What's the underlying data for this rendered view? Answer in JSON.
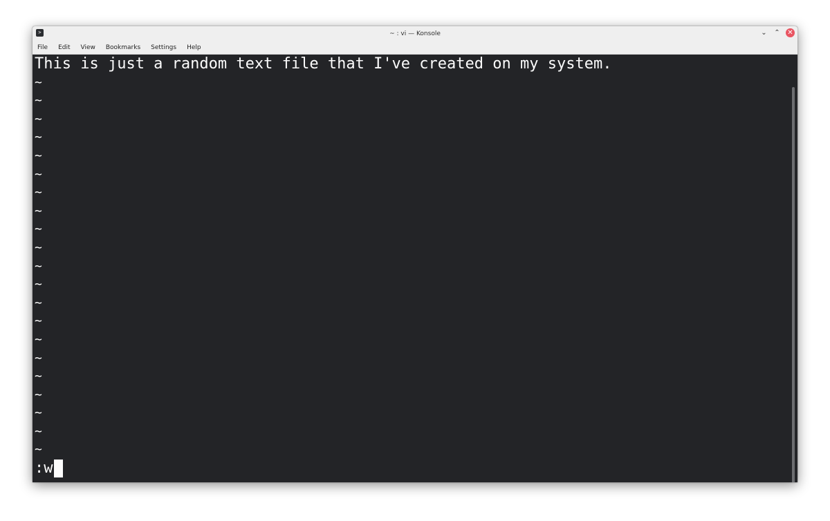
{
  "window": {
    "title": "~ : vi — Konsole",
    "icon": "konsole-terminal-icon",
    "controls": {
      "minimize": "⌄",
      "maximize": "⌃",
      "close": "✕"
    }
  },
  "menubar": {
    "items": [
      "File",
      "Edit",
      "View",
      "Bookmarks",
      "Settings",
      "Help"
    ]
  },
  "editor": {
    "first_line": "This is just a random text file that I've created on my system.",
    "empty_line_marker": "~",
    "empty_line_count": 21,
    "command": ":w"
  },
  "colors": {
    "terminal_bg": "#232427",
    "terminal_fg": "#fcfcfc",
    "titlebar_bg": "#efefef",
    "close_button": "#e95562"
  }
}
